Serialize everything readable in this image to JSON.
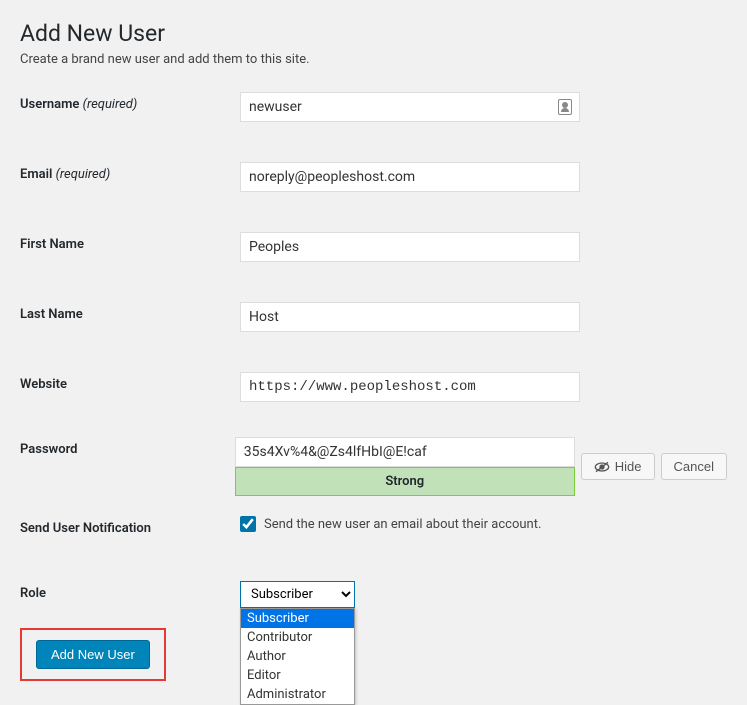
{
  "page": {
    "title": "Add New User",
    "subtitle": "Create a brand new user and add them to this site."
  },
  "labels": {
    "username": "Username",
    "required": " (required)",
    "email": "Email",
    "first_name": "First Name",
    "last_name": "Last Name",
    "website": "Website",
    "password": "Password",
    "send_notification": "Send User Notification",
    "role": "Role"
  },
  "values": {
    "username": "newuser",
    "email": "noreply@peopleshost.com",
    "first_name": "Peoples",
    "last_name": "Host",
    "website": "https://www.peopleshost.com",
    "password": "35s4Xv%4&@Zs4lfHbI@E!caf",
    "notification_checked": true
  },
  "password_meter": {
    "hide_label": "Hide",
    "cancel_label": "Cancel",
    "strength": "Strong"
  },
  "notification": {
    "checkbox_label": "Send the new user an email about their account."
  },
  "role": {
    "selected": "Subscriber",
    "options": [
      "Subscriber",
      "Contributor",
      "Author",
      "Editor",
      "Administrator"
    ]
  },
  "submit": {
    "button_label": "Add New User"
  }
}
